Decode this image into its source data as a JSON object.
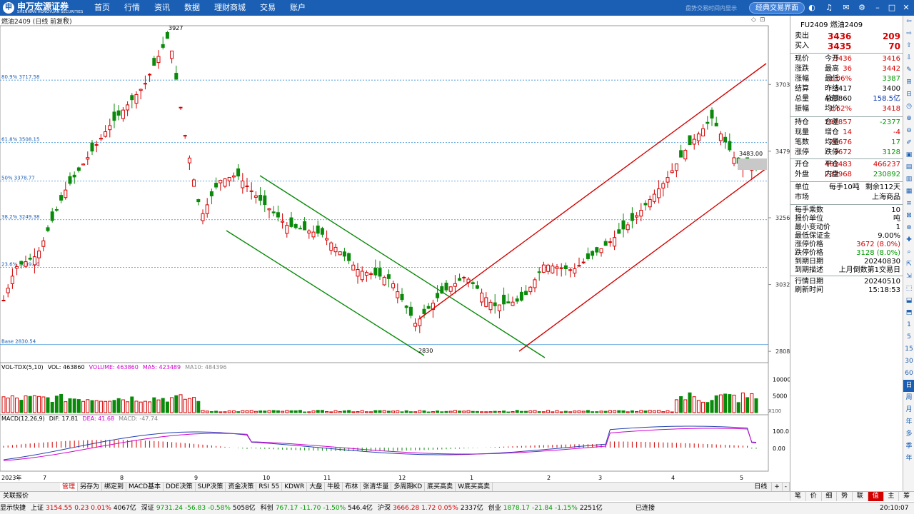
{
  "app": {
    "brand": "申万宏源证券",
    "brand_en": "SHENWAN HONGYUAN SECURITIES",
    "nav": [
      "首页",
      "行情",
      "资讯",
      "数据",
      "理财商城",
      "交易",
      "账户"
    ],
    "hint": "盘势交易时间内显示",
    "classic_btn": "经典交易界面"
  },
  "chart": {
    "title": "燃油2409 (日线 前复权)"
  },
  "chart_data": [
    {
      "type": "candlestick",
      "title": "燃油2409 (日线 前复权)",
      "xlabels": [
        "2023年",
        "7",
        "8",
        "9",
        "10",
        "11",
        "12",
        "1",
        "2",
        "3",
        "4",
        "5"
      ],
      "yticks": [
        3703,
        3479,
        3256,
        3032,
        2808
      ],
      "ylim": [
        2770,
        3900
      ],
      "high_marker": "3927",
      "low_marker": "2830",
      "fib_levels": [
        {
          "label": "80.9% 3717.58",
          "value": 3717.58
        },
        {
          "label": "61.8% 3508.15",
          "value": 3508.15
        },
        {
          "label": "50% 3378.77",
          "value": 3378.77
        },
        {
          "label": "38.2% 3249.38",
          "value": 3249.38
        },
        {
          "label": "23.6% 3089.30",
          "value": 3089.3
        },
        {
          "label": "Base 2830.54",
          "value": 2830.54
        }
      ],
      "last_price_label": "3483.00",
      "down_channel": {
        "color": "#0a8a0a"
      },
      "up_channel": {
        "color": "#d40000"
      }
    },
    {
      "type": "bar",
      "title": "VOL-TDX(5,10)",
      "series": [
        {
          "name": "VOL",
          "value": "463860"
        },
        {
          "name": "VOLUME",
          "value": "463860"
        },
        {
          "name": "MA5",
          "value": "423489"
        },
        {
          "name": "MA10",
          "value": "484396"
        }
      ],
      "yticks": [
        10000,
        5000
      ],
      "yunit": "X100"
    },
    {
      "type": "line",
      "title": "MACD(12,26,9)",
      "series": [
        {
          "name": "DIF",
          "value": "17.81"
        },
        {
          "name": "DEA",
          "value": "41.68"
        },
        {
          "name": "MACD",
          "value": "-47.74"
        }
      ],
      "yticks": [
        "100.0",
        "0.00"
      ]
    }
  ],
  "panel": {
    "code": "FU2409 燃油2409",
    "sell": {
      "label": "卖出",
      "price": "3436",
      "vol": "209"
    },
    "buy": {
      "label": "买入",
      "price": "3435",
      "vol": "70"
    },
    "quote": [
      [
        "现价",
        "3436",
        "今开",
        "3416"
      ],
      [
        "涨跌",
        "36",
        "最高",
        "3442"
      ],
      [
        "涨幅",
        "1.06%",
        "最低",
        "3387"
      ],
      [
        "结算",
        "3417",
        "昨结",
        "3400"
      ],
      [
        "总量",
        "463860",
        "总额",
        "158.5亿"
      ],
      [
        "振幅",
        "1.62%",
        "均价",
        "3418"
      ]
    ],
    "pos": [
      [
        "持仓",
        "297857",
        "仓差",
        "-2377"
      ],
      [
        "现量",
        "14",
        "增仓",
        "-4"
      ],
      [
        "笔数",
        "26676",
        "均量",
        "17"
      ],
      [
        "涨停",
        "3672",
        "跌停",
        "3128"
      ]
    ],
    "oc": [
      [
        "开仓",
        "461483",
        "平仓",
        "466237"
      ],
      [
        "外盘",
        "232968",
        "内盘",
        "230892"
      ]
    ],
    "unit": {
      "label": "单位",
      "v1": "每手10吨",
      "v2": "剩余112天"
    },
    "market": {
      "label": "市场",
      "value": "上海商品"
    },
    "spec": [
      [
        "每手乘数",
        "10"
      ],
      [
        "报价单位",
        "吨"
      ],
      [
        "最小变动价",
        "1"
      ],
      [
        "最低保证金",
        "9.00%"
      ],
      [
        "涨停价格",
        "3672 (8.0%)"
      ],
      [
        "跌停价格",
        "3128 (8.0%)"
      ],
      [
        "到期日期",
        "20240830"
      ],
      [
        "到期描述",
        "上月倒数第1交易日"
      ]
    ],
    "date": [
      [
        "行情日期",
        "20240510"
      ],
      [
        "刷新时间",
        "15:18:53"
      ]
    ]
  },
  "rtools": [
    "日",
    "周",
    "月",
    "年",
    "多",
    "季",
    "年"
  ],
  "bottom_tabs": [
    "管理",
    "另存为",
    "绑定到",
    "MACD基本",
    "DDE决策",
    "SUP决策",
    "资金决策",
    "RSI 55",
    "KDWR",
    "大盘",
    "牛股",
    "布林",
    "张清华量",
    "多周期KD",
    "底买高卖",
    "W底买高卖"
  ],
  "bottom_right": "日线",
  "gl_label": "关联报价",
  "right_tabs": [
    "笔",
    "价",
    "细",
    "势",
    "联",
    "值",
    "主",
    "筹"
  ],
  "status": {
    "items": [
      "显示快捷",
      "上证",
      "3154.55",
      "0.23",
      "0.01%",
      "4067亿",
      "深证",
      "9731.24",
      "-56.83",
      "-0.58%",
      "5058亿",
      "科创",
      "767.17",
      "-11.70",
      "-1.50%",
      "546.4亿",
      "沪深",
      "3666.28",
      "1.72",
      "0.05%",
      "2337亿",
      "创业",
      "1878.17",
      "-21.84",
      "-1.15%",
      "2251亿"
    ],
    "conn": "已连接",
    "time": "20:10:07"
  }
}
